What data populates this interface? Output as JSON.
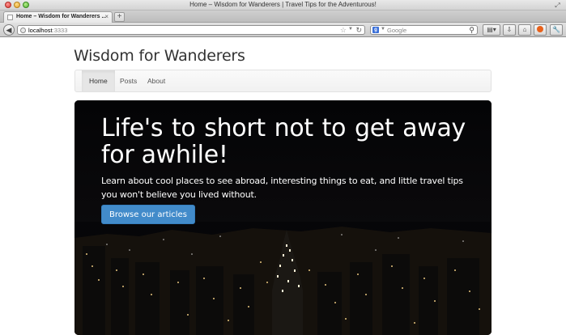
{
  "window": {
    "title": "Home – Wisdom for Wanderers | Travel Tips for the Adventurous!"
  },
  "tab": {
    "title": "Home – Wisdom for Wanderers ...",
    "close_glyph": "×",
    "new_tab_glyph": "+"
  },
  "toolbar": {
    "back_glyph": "◀",
    "url_host": "localhost",
    "url_port": ":3333",
    "search_engine": "g",
    "search_placeholder": "Google"
  },
  "site": {
    "brand": "Wisdom for Wanderers",
    "nav": [
      {
        "label": "Home",
        "active": true
      },
      {
        "label": "Posts",
        "active": false
      },
      {
        "label": "About",
        "active": false
      }
    ]
  },
  "hero": {
    "heading": "Life's to short not to get away for awhile!",
    "text": "Learn about cool places to see abroad, interesting things to eat, and little travel tips you won't believe you lived without.",
    "button_label": "Browse our articles"
  },
  "colors": {
    "primary_button": "#428bca",
    "hero_background": "#050508",
    "brand_text": "#333333"
  },
  "icons": {
    "back": "back-arrow-icon",
    "site": "globe-icon",
    "bookmark": "star-icon",
    "reload": "reload-icon",
    "search": "magnifier-icon",
    "bookmarks_menu": "bookmarks-icon",
    "downloads": "download-icon",
    "home": "home-icon",
    "addon": "firebug-icon",
    "tools": "wrench-icon"
  }
}
